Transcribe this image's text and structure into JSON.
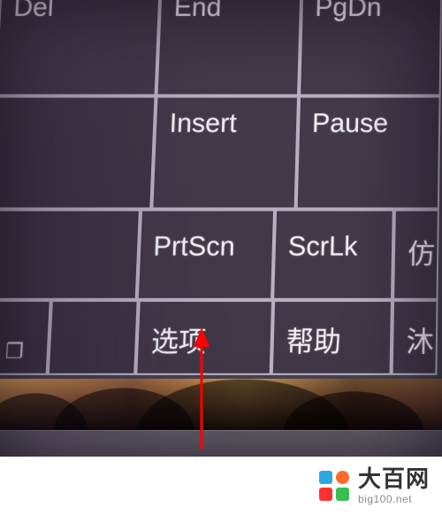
{
  "keyboard": {
    "row1": {
      "del": "Del",
      "end": "End",
      "pgdn": "PgDn"
    },
    "row2": {
      "blank": "",
      "insert": "Insert",
      "pause": "Pause"
    },
    "row3": {
      "blank": "",
      "prtscn": "PrtScn",
      "scrlk": "ScrLk",
      "frag": "仿"
    },
    "row4": {
      "dock_glyph": "❐",
      "blank": "",
      "options": "选项",
      "help": "帮助",
      "frag": "沐"
    }
  },
  "annotation": {
    "arrow_color": "#ff0000"
  },
  "watermark": {
    "title_cn": "大百网",
    "title_en": "big100.net"
  }
}
